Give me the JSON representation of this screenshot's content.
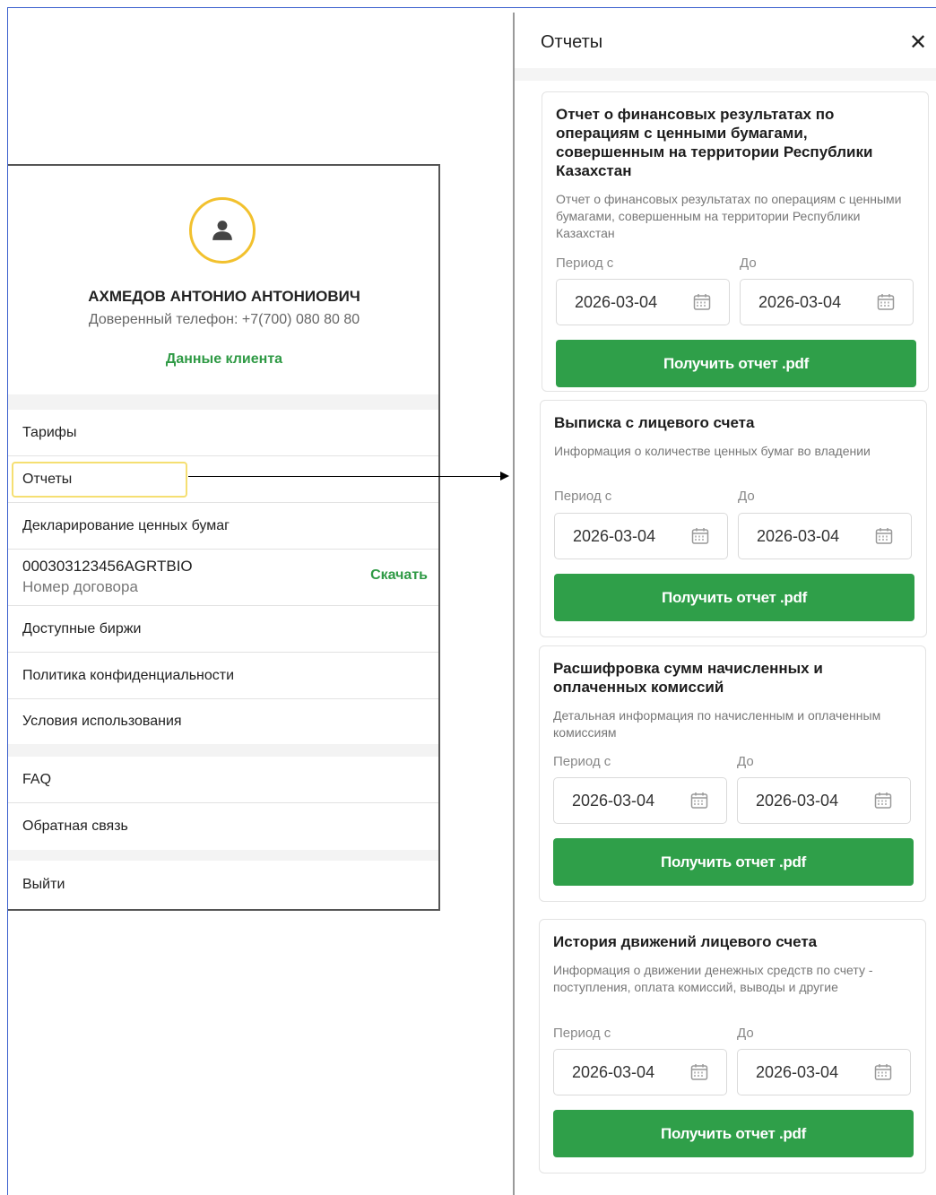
{
  "profile": {
    "name": "АХМЕДОВ АНТОНИО АНТОНИОВИЧ",
    "phone": "Доверенный телефон: +7(700) 080 80 80",
    "client_data_link": "Данные клиента",
    "menu": {
      "tariffs": "Тарифы",
      "reports": "Отчеты",
      "declaration": "Декларирование ценных бумаг",
      "contract_number": "000303123456AGRTBIO",
      "contract_label": "Номер договора",
      "download": "Скачать",
      "exchanges": "Доступные биржи",
      "privacy": "Политика конфиденциальности",
      "terms": "Условия использования",
      "faq": "FAQ",
      "feedback": "Обратная связь",
      "logout": "Выйти"
    }
  },
  "reports": {
    "title": "Отчеты",
    "close_icon": "close-icon",
    "cards": [
      {
        "title": "Отчет о финансовых результатах по операциям с ценными бумагами, совершенным на территории Республики Казахстан",
        "description": "Отчет о финансовых результатах по операциям с ценными бумагами, совершенным на территории Республики Казахстан",
        "from_label": "Период с",
        "to_label": "До",
        "from": "2026-03-04",
        "to": "2026-03-04",
        "button": "Получить отчет .pdf"
      },
      {
        "title": "Выписка с лицевого счета",
        "description": "Информация о количестве ценных бумаг во владении",
        "from_label": "Период с",
        "to_label": "До",
        "from": "2026-03-04",
        "to": "2026-03-04",
        "button": "Получить отчет .pdf"
      },
      {
        "title": "Расшифровка сумм начисленных и оплаченных комиссий",
        "description": "Детальная информация по начисленным и оплаченным комиссиям",
        "from_label": "Период с",
        "to_label": "До",
        "from": "2026-03-04",
        "to": "2026-03-04",
        "button": "Получить отчет .pdf"
      },
      {
        "title": "История движений лицевого счета",
        "description": "Информация о движении денежных средств по счету - поступления, оплата комиссий, выводы и другие",
        "from_label": "Период с",
        "to_label": "До",
        "from": "2026-03-04",
        "to": "2026-03-04",
        "button": "Получить отчет .pdf"
      }
    ]
  },
  "colors": {
    "accent_green": "#2f9f49",
    "avatar_ring": "#f2c12e",
    "highlight": "#f5df72"
  }
}
